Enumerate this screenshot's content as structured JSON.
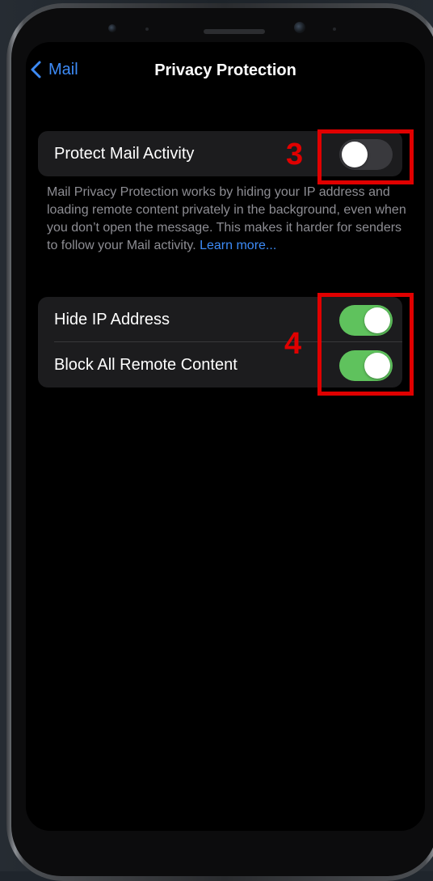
{
  "nav": {
    "back_label": "Mail",
    "title": "Privacy Protection"
  },
  "protect_group": {
    "row_label": "Protect Mail Activity",
    "toggle_on": false
  },
  "footnote": {
    "text": "Mail Privacy Protection works by hiding your IP address and loading remote content privately in the background, even when you don’t open the message. This makes it harder for senders to follow your Mail activity.",
    "link": "Learn more..."
  },
  "privacy_group": {
    "rows": [
      {
        "label": "Hide IP Address",
        "toggle_on": true
      },
      {
        "label": "Block All Remote Content",
        "toggle_on": true
      }
    ]
  },
  "annotations": {
    "step_3": "3",
    "step_4": "4",
    "highlight_color": "#e00000"
  },
  "colors": {
    "accent": "#3d8bf7",
    "toggle_on": "#5fc25d",
    "toggle_off": "#39393d",
    "group_bg": "#1c1c1e"
  }
}
